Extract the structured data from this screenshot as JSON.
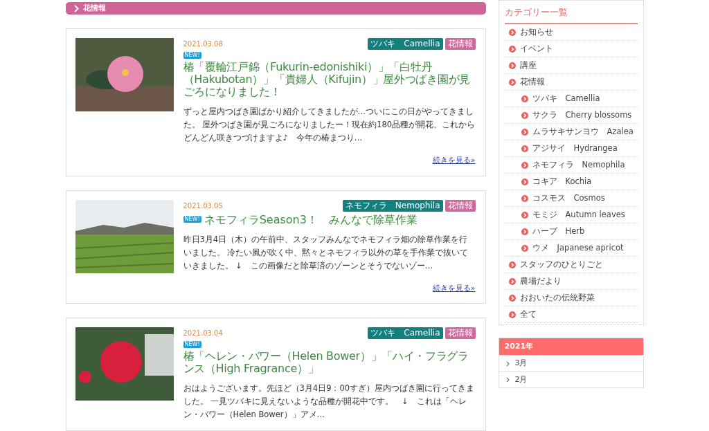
{
  "section_header": {
    "title": "花情報"
  },
  "posts": [
    {
      "date": "2021.03.08",
      "tags": [
        {
          "label": "ツバキ　Camellia",
          "color": "#11807f"
        },
        {
          "label": "花情報",
          "color": "#cf689b"
        }
      ],
      "badge": "NEW!",
      "badge_inline": false,
      "title": "椿「覆輪江戸錦（Fukurin-edonishiki）」「白牡丹（Hakubotan）」「貴婦人（Kifujin）」屋外つばき園が見ごろになりました！",
      "excerpt": "ずっと屋内つばき園ばかり紹介してきましたが…ついにこの日がやってきました。 屋外つばき園が見ごろになりましたー！現在約180品種が開花、これからどんどん咲きつづけますよ♪　今年の椿まつり…",
      "more": "続きを見る»"
    },
    {
      "date": "2021.03.05",
      "tags": [
        {
          "label": "ネモフィラ　Nemophila",
          "color": "#11807f"
        },
        {
          "label": "花情報",
          "color": "#cf689b"
        }
      ],
      "badge": "NEW!",
      "badge_inline": true,
      "title": "ネモフィラSeason3！　みんなで除草作業",
      "excerpt": "昨日3月4日（木）の午前中、スタッフみんなでネモフィラ畑の除草作業を行いました。 冷たい風が吹く中、黙々とネモフィラ以外の草を手作業で抜いていきました。 ↓　この画像だと除草済のゾーンとそうでないゾー…",
      "more": "続きを見る»"
    },
    {
      "date": "2021.03.04",
      "tags": [
        {
          "label": "ツバキ　Camellia",
          "color": "#11807f"
        },
        {
          "label": "花情報",
          "color": "#cf689b"
        }
      ],
      "badge": "NEW!",
      "badge_inline": false,
      "title": "椿「ヘレン・バワー（Helen Bower）」「ハイ・フラグランス（High Fragrance）」",
      "excerpt": "おはようございます。先ほど（3月4日9：00すぎ）屋内つばき園に行ってきました。 一見ツバキに見えないような品種が開花中です。　↓　これは「ヘレン・バワー（Helen Bower）」アメ…"
    }
  ],
  "sidebar": {
    "categories_title": "カテゴリー一覧",
    "categories": [
      {
        "label": "お知らせ"
      },
      {
        "label": "イベント"
      },
      {
        "label": "講座"
      },
      {
        "label": "花情報",
        "children": [
          {
            "label": "ツバキ　Camellia"
          },
          {
            "label": "サクラ　Cherry blossoms"
          },
          {
            "label": "ムラサキサンヨウ　Azalea"
          },
          {
            "label": "アジサイ　Hydrangea"
          },
          {
            "label": "ネモフィラ　Nemophila"
          },
          {
            "label": "コキア　Kochia"
          },
          {
            "label": "コスモス　Cosmos"
          },
          {
            "label": "モミジ　Autumn leaves"
          },
          {
            "label": "ハーブ　Herb"
          },
          {
            "label": "ウメ　Japanese apricot"
          }
        ]
      },
      {
        "label": "スタッフのひとりごと"
      },
      {
        "label": "農場だより"
      },
      {
        "label": "おおいたの伝統野菜"
      },
      {
        "label": "全て"
      }
    ],
    "archive_title": "2021年",
    "archive": [
      "3月",
      "2月"
    ]
  }
}
